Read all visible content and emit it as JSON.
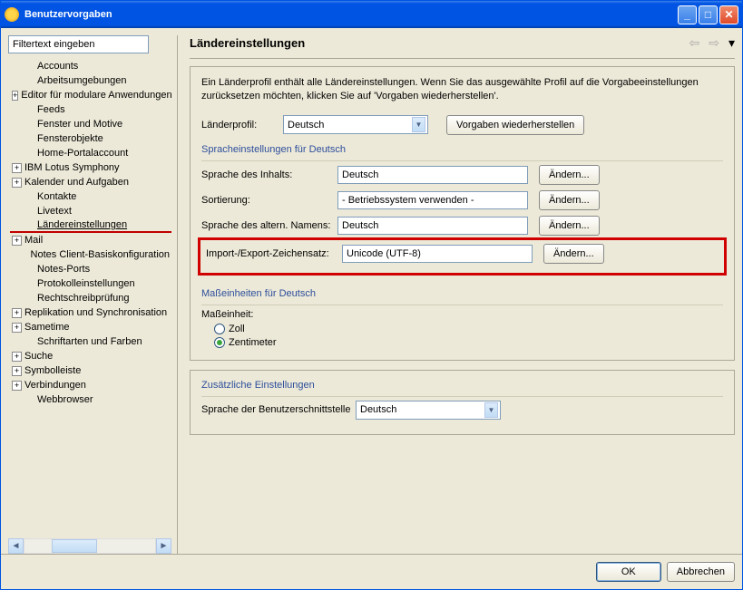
{
  "window": {
    "title": "Benutzervorgaben"
  },
  "filter": {
    "placeholder": "Filtertext eingeben"
  },
  "tree": {
    "items": [
      {
        "label": "Accounts",
        "exp": null,
        "indent": true
      },
      {
        "label": "Arbeitsumgebungen",
        "exp": null,
        "indent": true
      },
      {
        "label": "Editor für modulare Anwendungen",
        "exp": "+",
        "indent": false
      },
      {
        "label": "Feeds",
        "exp": null,
        "indent": true
      },
      {
        "label": "Fenster und Motive",
        "exp": null,
        "indent": true
      },
      {
        "label": "Fensterobjekte",
        "exp": null,
        "indent": true
      },
      {
        "label": "Home-Portalaccount",
        "exp": null,
        "indent": true
      },
      {
        "label": "IBM Lotus Symphony",
        "exp": "+",
        "indent": false
      },
      {
        "label": "Kalender und Aufgaben",
        "exp": "+",
        "indent": false
      },
      {
        "label": "Kontakte",
        "exp": null,
        "indent": true
      },
      {
        "label": "Livetext",
        "exp": null,
        "indent": true
      },
      {
        "label": "Ländereinstellungen",
        "exp": null,
        "indent": true,
        "selected": true
      },
      {
        "label": "Mail",
        "exp": "+",
        "indent": false
      },
      {
        "label": "Notes Client-Basiskonfiguration",
        "exp": null,
        "indent": true
      },
      {
        "label": "Notes-Ports",
        "exp": null,
        "indent": true
      },
      {
        "label": "Protokolleinstellungen",
        "exp": null,
        "indent": true
      },
      {
        "label": "Rechtschreibprüfung",
        "exp": null,
        "indent": true
      },
      {
        "label": "Replikation und Synchronisation",
        "exp": "+",
        "indent": false
      },
      {
        "label": "Sametime",
        "exp": "+",
        "indent": false
      },
      {
        "label": "Schriftarten und Farben",
        "exp": null,
        "indent": true
      },
      {
        "label": "Suche",
        "exp": "+",
        "indent": false
      },
      {
        "label": "Symbolleiste",
        "exp": "+",
        "indent": false
      },
      {
        "label": "Verbindungen",
        "exp": "+",
        "indent": false
      },
      {
        "label": "Webbrowser",
        "exp": null,
        "indent": true
      }
    ]
  },
  "page": {
    "title": "Ländereinstellungen",
    "desc": "Ein Länderprofil enthält alle Ländereinstellungen. Wenn Sie das ausgewählte Profil auf die Vorgabeeinstellungen zurücksetzen möchten, klicken Sie auf 'Vorgaben wiederherstellen'.",
    "profile_label": "Länderprofil:",
    "profile_value": "Deutsch",
    "restore_btn": "Vorgaben wiederherstellen",
    "lang_group": "Spracheinstellungen für Deutsch",
    "rows": [
      {
        "label": "Sprache des Inhalts:",
        "value": "Deutsch",
        "btn": "Ändern..."
      },
      {
        "label": "Sortierung:",
        "value": "- Betriebssystem verwenden -",
        "btn": "Ändern..."
      },
      {
        "label": "Sprache des altern. Namens:",
        "value": "Deutsch",
        "btn": "Ändern..."
      },
      {
        "label": "Import-/Export-Zeichensatz:",
        "value": "Unicode (UTF-8)",
        "btn": "Ändern..."
      }
    ],
    "units_group": "Maßeinheiten für Deutsch",
    "units_label": "Maßeinheit:",
    "radio_inch": "Zoll",
    "radio_cm": "Zentimeter",
    "extra_group": "Zusätzliche Einstellungen",
    "ui_lang_label": "Sprache der Benutzerschnittstelle",
    "ui_lang_value": "Deutsch"
  },
  "footer": {
    "ok": "OK",
    "cancel": "Abbrechen"
  }
}
